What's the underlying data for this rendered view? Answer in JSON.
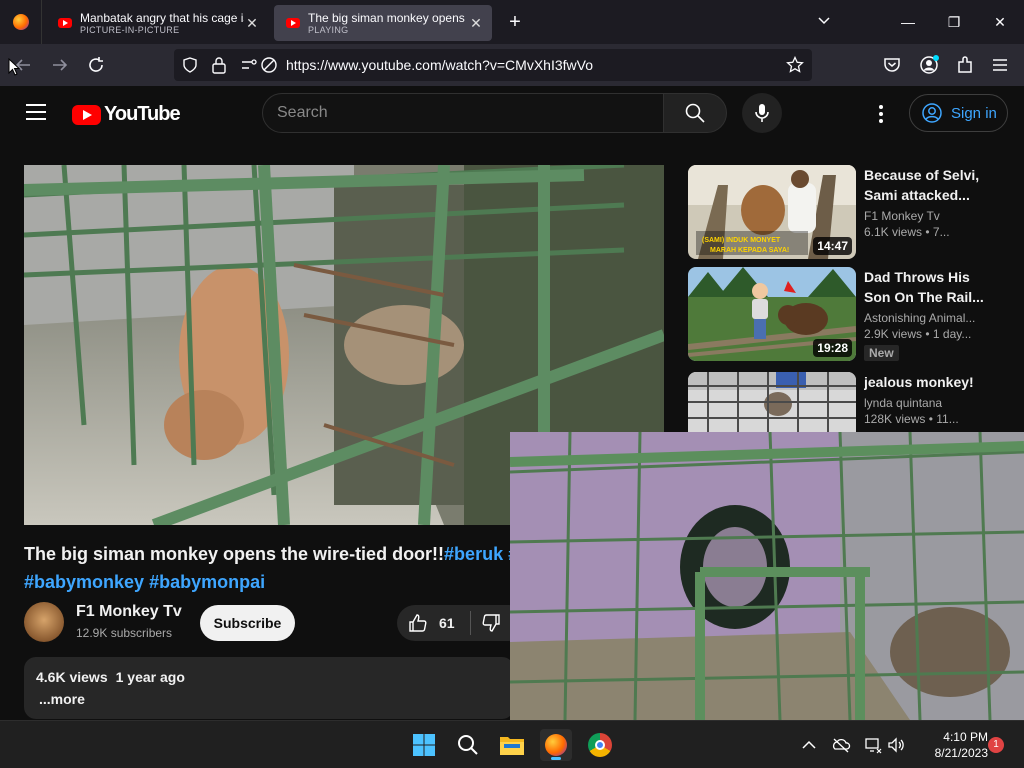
{
  "browser": {
    "tabs": [
      {
        "title": "Manbatak angry that his cage is",
        "subtitle": "PICTURE-IN-PICTURE"
      },
      {
        "title": "The big siman monkey opens the",
        "subtitle": "PLAYING"
      }
    ],
    "url": "https://www.youtube.com/watch?v=CMvXhI3fwVo"
  },
  "youtube": {
    "logo_text": "YouTube",
    "search_placeholder": "Search",
    "sign_in": "Sign in"
  },
  "video": {
    "title_main": "The big siman monkey opens the wire-tied door!!",
    "title_tag1": "#beruk",
    "title_tag1_overflow": "#",
    "title_tag2": "#babymonkey",
    "title_tag3": "#babymonpai",
    "channel_name": "F1 Monkey Tv",
    "channel_subs": "12.9K subscribers",
    "subscribe_label": "Subscribe",
    "likes": "61",
    "views": "4.6K views",
    "age": "1 year ago",
    "more": "...more"
  },
  "recommendations": [
    {
      "title": "Because of Selvi, Sami attacked...",
      "channel": "F1 Monkey Tv",
      "meta": "6.1K views  •  7...",
      "duration": "14:47",
      "badge": ""
    },
    {
      "title": "Dad Throws His Son On The Rail...",
      "channel": "Astonishing Animal...",
      "meta": "2.9K views  •  1 day...",
      "duration": "19:28",
      "badge": "New"
    },
    {
      "title": "jealous monkey!",
      "channel": "lynda quintana",
      "meta": "128K views  •  11...",
      "duration": "",
      "badge": ""
    }
  ],
  "thumb_text": {
    "rec1_caption_line1": "(SAMI) INDUK MONYET",
    "rec1_caption_line2": "MARAH KEPADA SAYA!"
  },
  "taskbar": {
    "time": "4:10 PM",
    "date": "8/21/2023",
    "notifications": "1"
  },
  "colors": {
    "yt_red": "#ff0000",
    "link_blue": "#3ea6ff",
    "bg": "#0f0f0f"
  }
}
